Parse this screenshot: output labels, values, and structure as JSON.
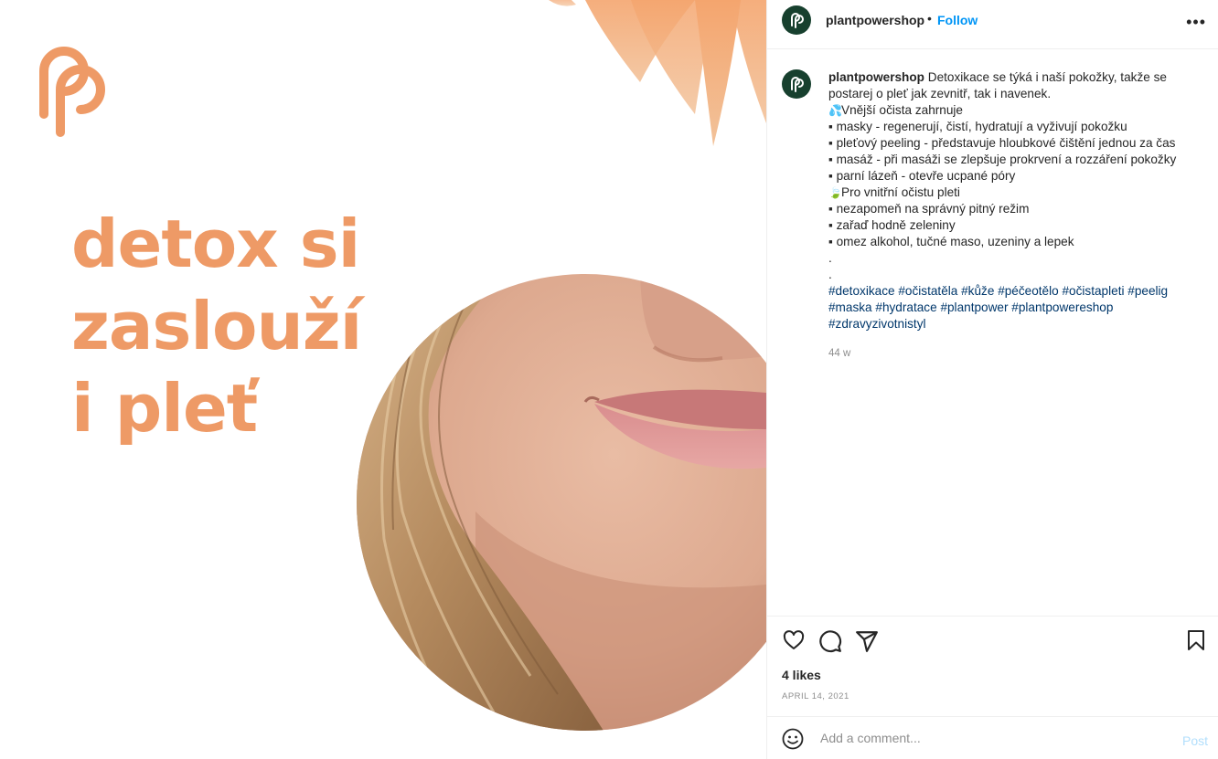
{
  "post": {
    "headline": [
      "detox si",
      "zaslouží",
      "i pleť"
    ],
    "brand_color": "#EE9A66"
  },
  "header": {
    "username": "plantpowershop",
    "separator": "•",
    "follow_label": "Follow",
    "more_icon": "more-horizontal-icon"
  },
  "caption": {
    "username": "plantpowershop",
    "lines": [
      "Detoxikace se týká i naší pokožky, takže se",
      "postarej o pleť jak zevnitř, tak i navenek.",
      "Vnější očista zahrnuje",
      "▪ masky - regenerují, čistí, hydratují a vyživují pokožku",
      "▪ pleťový peeling - představuje hloubkové čištění jednou za čas",
      "▪ masáž - při masáži se zlepšuje prokrvení a rozzáření pokožky",
      "▪ parní lázeň - otevře ucpané póry",
      "Pro vnitřní očistu pleti",
      "▪ nezapomeň na správný pitný režim",
      "▪ zařaď hodně zeleniny",
      "▪ omez alkohol, tučné maso, uzeniny a lepek",
      ".",
      "."
    ],
    "hashtags": [
      "#detoxikace",
      "#očistatěla",
      "#kůže",
      "#péčeotělo",
      "#očistapleti",
      "#peelig",
      "#maska",
      "#hydratace",
      "#plantpower",
      "#plantpowereshop",
      "#zdravyzivotnistyl"
    ],
    "time_ago": "44 w"
  },
  "actions": {
    "likes": "4 likes",
    "date": "APRIL 14, 2021",
    "icons": [
      "heart-icon",
      "comment-icon",
      "share-icon",
      "bookmark-icon"
    ]
  },
  "comment": {
    "placeholder": "Add a comment...",
    "post_label": "Post"
  }
}
